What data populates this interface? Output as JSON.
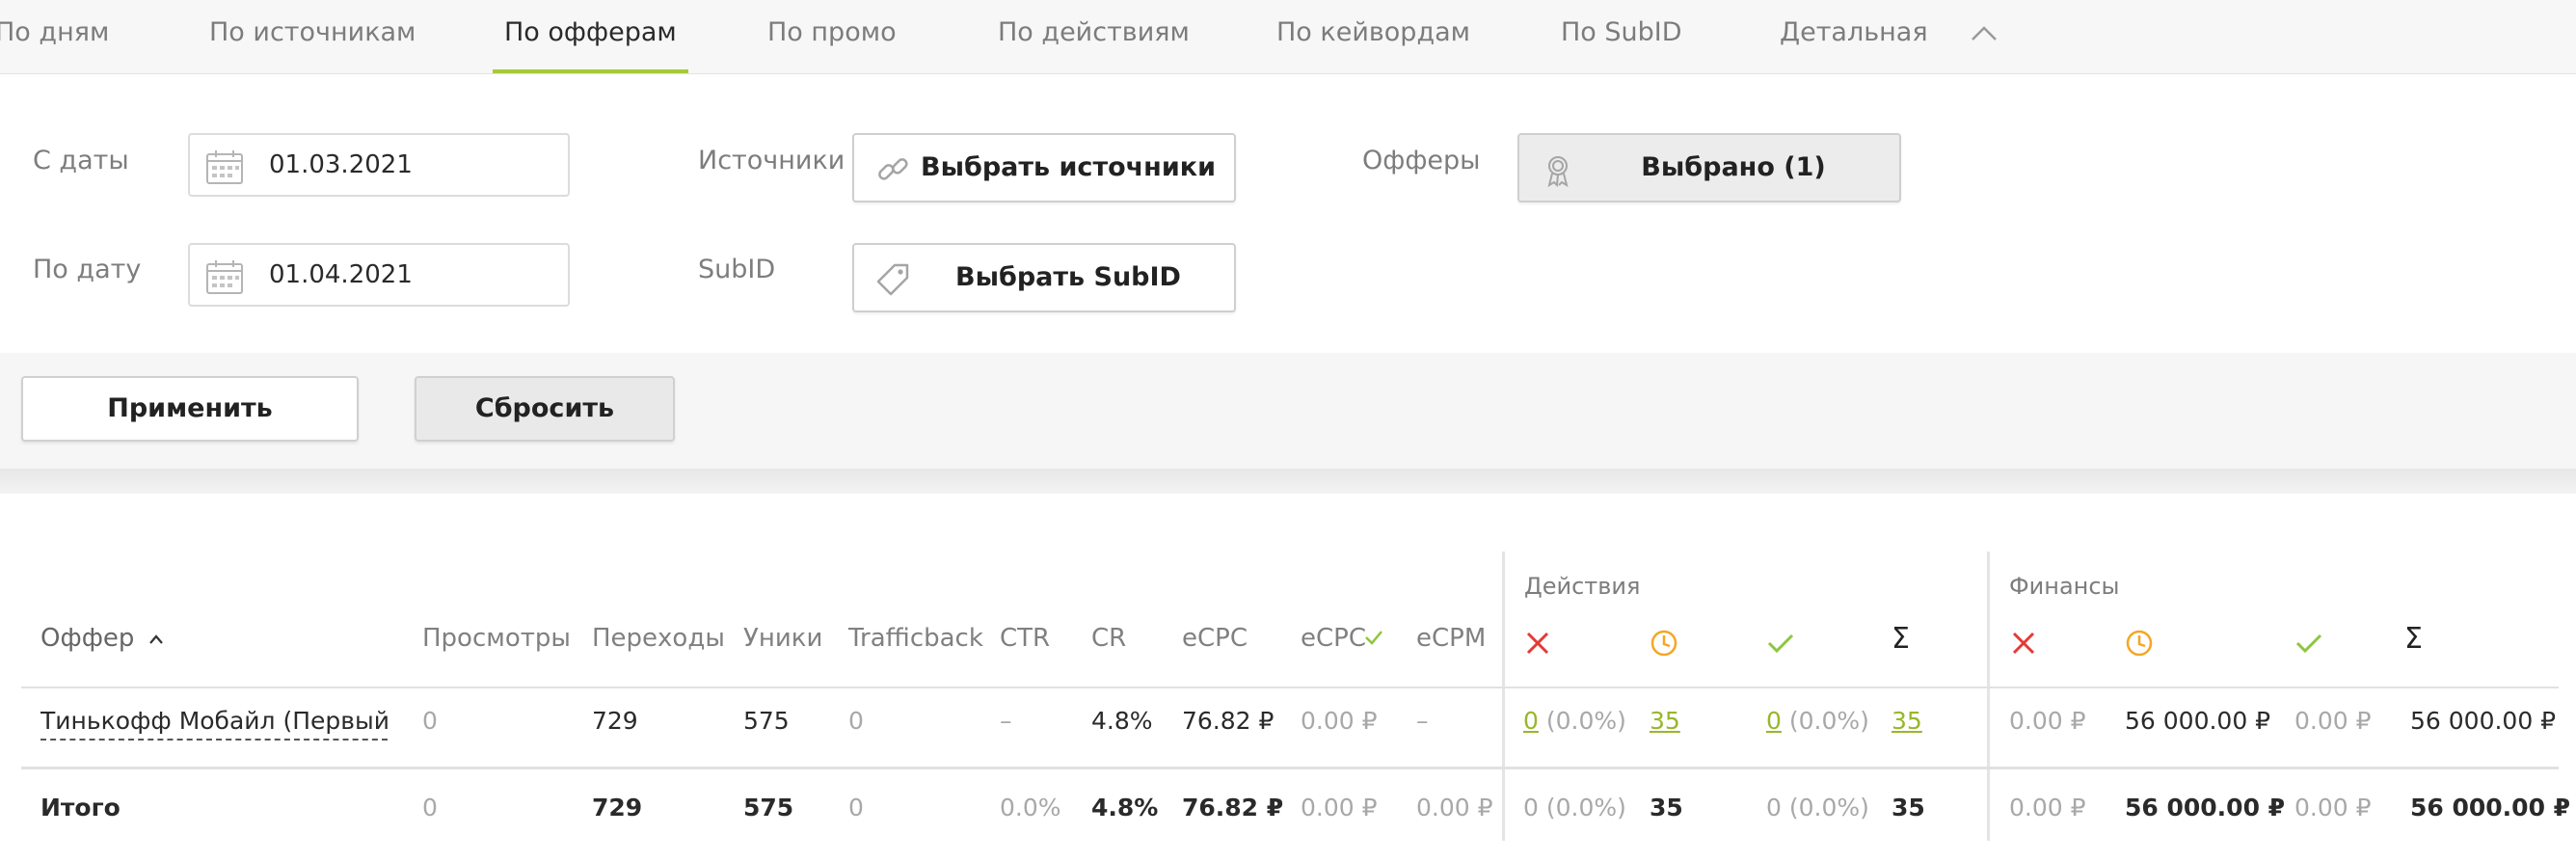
{
  "tabs": [
    {
      "label": "По дням"
    },
    {
      "label": "По источникам"
    },
    {
      "label": "По офферам"
    },
    {
      "label": "По промо"
    },
    {
      "label": "По действиям"
    },
    {
      "label": "По кейвордам"
    },
    {
      "label": "По SubID"
    },
    {
      "label": "Детальная"
    }
  ],
  "active_tab": "По офферам",
  "filters": {
    "date_from_label": "С даты",
    "date_from_value": "01.03.2021",
    "date_to_label": "По дату",
    "date_to_value": "01.04.2021",
    "sources_label": "Источники",
    "sources_button": "Выбрать источники",
    "subid_label": "SubID",
    "subid_button": "Выбрать SubID",
    "offers_label": "Офферы",
    "offers_button": "Выбрано (1)"
  },
  "actions": {
    "apply": "Применить",
    "reset": "Сбросить"
  },
  "table": {
    "groups": {
      "actions": "Действия",
      "finance": "Финансы"
    },
    "headers": {
      "offer": "Оффер",
      "views": "Просмотры",
      "clicks": "Переходы",
      "uniques": "Уники",
      "trafficback": "Trafficback",
      "ctr": "CTR",
      "cr": "CR",
      "ecpc": "eCPC",
      "ecpc_approved": "eCPC",
      "ecpm": "eCPM"
    },
    "status_icons": [
      "cross-icon",
      "clock-icon",
      "check-icon",
      "sigma-icon"
    ],
    "colors": {
      "accent": "#a7c938",
      "reject": "#e53935",
      "pending": "#f5a623",
      "approve": "#8dc63f"
    },
    "row": {
      "offer": "Тинькофф Мобайл (Первый платеж)",
      "views": "0",
      "clicks": "729",
      "uniques": "575",
      "trafficback": "0",
      "ctr": "–",
      "cr": "4.8%",
      "ecpc": "76.82 ₽",
      "ecpc_approved": "0.00 ₽",
      "ecpm": "–",
      "act_rejected_n": "0",
      "act_rejected_pct": "(0.0%)",
      "act_pending": "35",
      "act_approved_n": "0",
      "act_approved_pct": "(0.0%)",
      "act_total": "35",
      "fin_rejected": "0.00 ₽",
      "fin_pending": "56 000.00 ₽",
      "fin_approved": "0.00 ₽",
      "fin_total": "56 000.00 ₽"
    },
    "total": {
      "label": "Итого",
      "views": "0",
      "clicks": "729",
      "uniques": "575",
      "trafficback": "0",
      "ctr": "0.0%",
      "cr": "4.8%",
      "ecpc": "76.82 ₽",
      "ecpc_approved": "0.00 ₽",
      "ecpm": "0.00 ₽",
      "act_rejected": "0 (0.0%)",
      "act_pending": "35",
      "act_approved": "0 (0.0%)",
      "act_total": "35",
      "fin_rejected": "0.00 ₽",
      "fin_pending": "56 000.00 ₽",
      "fin_approved": "0.00 ₽",
      "fin_total": "56 000.00 ₽"
    }
  }
}
